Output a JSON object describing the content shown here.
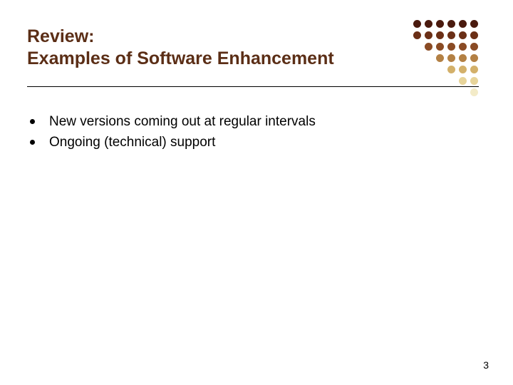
{
  "title_line1": "Review:",
  "title_line2": "Examples of Software Enhancement",
  "bullets": [
    "New versions coming out at regular intervals",
    "Ongoing (technical) support"
  ],
  "page_number": "3",
  "dot_colors": {
    "rows": [
      [
        "#4a1a0e",
        "#4a1a0e",
        "#4a1a0e",
        "#4a1a0e",
        "#4a1a0e",
        "#4a1a0e"
      ],
      [
        "#6b2f16",
        "#6b2f16",
        "#6b2f16",
        "#6b2f16",
        "#6b2f16",
        "#6b2f16"
      ],
      [
        "",
        "#8a4b24",
        "#8a4b24",
        "#8a4b24",
        "#8a4b24",
        "#8a4b24"
      ],
      [
        "",
        "",
        "#b38044",
        "#b38044",
        "#b38044",
        "#b38044"
      ],
      [
        "",
        "",
        "",
        "#d3b06a",
        "#d3b06a",
        "#d3b06a"
      ],
      [
        "",
        "",
        "",
        "",
        "#e7d49a",
        "#e7d49a"
      ],
      [
        "",
        "",
        "",
        "",
        "",
        "#f3ebc8"
      ]
    ]
  }
}
